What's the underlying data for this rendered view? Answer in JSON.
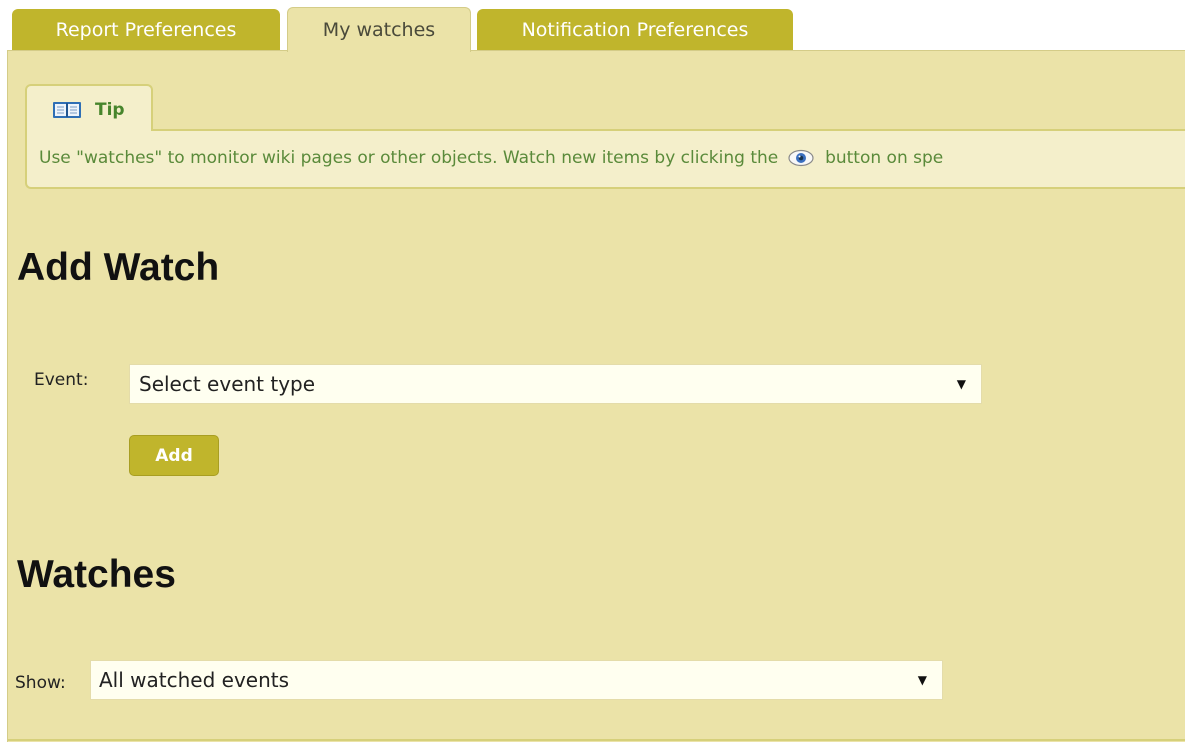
{
  "tabs": [
    {
      "label": "Report Preferences",
      "active": false
    },
    {
      "label": "My watches",
      "active": true
    },
    {
      "label": "Notification Preferences",
      "active": false
    }
  ],
  "tip": {
    "title": "Tip",
    "icon": "book-icon",
    "text_before": "Use \"watches\" to monitor wiki pages or other objects. Watch new items by clicking the",
    "inline_icon": "eye-icon",
    "text_after": "button on spe"
  },
  "add_watch": {
    "heading": "Add Watch",
    "event_label": "Event:",
    "event_select_value": "Select event type",
    "add_button": "Add"
  },
  "watches": {
    "heading": "Watches",
    "show_label": "Show:",
    "show_select_value": "All watched events"
  },
  "colors": {
    "tab_inactive": "#c0b52c",
    "panel_bg": "#ebe3a8",
    "tip_bg": "#f4efcb",
    "tip_text": "#5a8a3a"
  }
}
